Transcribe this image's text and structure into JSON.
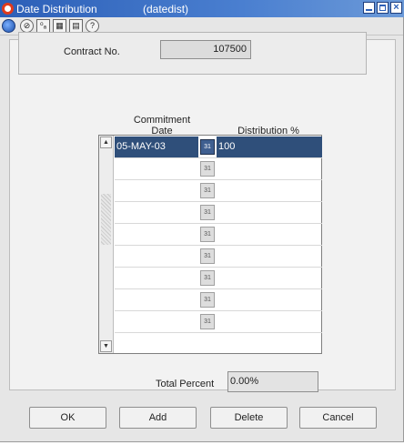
{
  "window": {
    "title": "Date Distribution",
    "subtitle": "(datedist)"
  },
  "toolbar": {
    "icons": [
      "globe-icon",
      "exit-icon",
      "help-icon",
      "calendar-icon",
      "print-icon",
      "question-icon"
    ],
    "glyphs": [
      "",
      "⊘",
      "⁰ₐ",
      "▦",
      "▤",
      "?"
    ]
  },
  "contract": {
    "label": "Contract No.",
    "value": "107500"
  },
  "grid": {
    "header_top": "Commitment",
    "col_date": "Date",
    "col_dist": "Distribution %",
    "calendar_glyph": "31",
    "rows": [
      {
        "date": "05-MAY-03",
        "dist": "100"
      },
      {
        "date": "",
        "dist": ""
      },
      {
        "date": "",
        "dist": ""
      },
      {
        "date": "",
        "dist": ""
      },
      {
        "date": "",
        "dist": ""
      },
      {
        "date": "",
        "dist": ""
      },
      {
        "date": "",
        "dist": ""
      },
      {
        "date": "",
        "dist": ""
      },
      {
        "date": "",
        "dist": ""
      }
    ]
  },
  "total": {
    "label": "Total Percent",
    "value": "0.00%"
  },
  "buttons": {
    "ok": "OK",
    "add": "Add",
    "delete": "Delete",
    "cancel": "Cancel"
  }
}
